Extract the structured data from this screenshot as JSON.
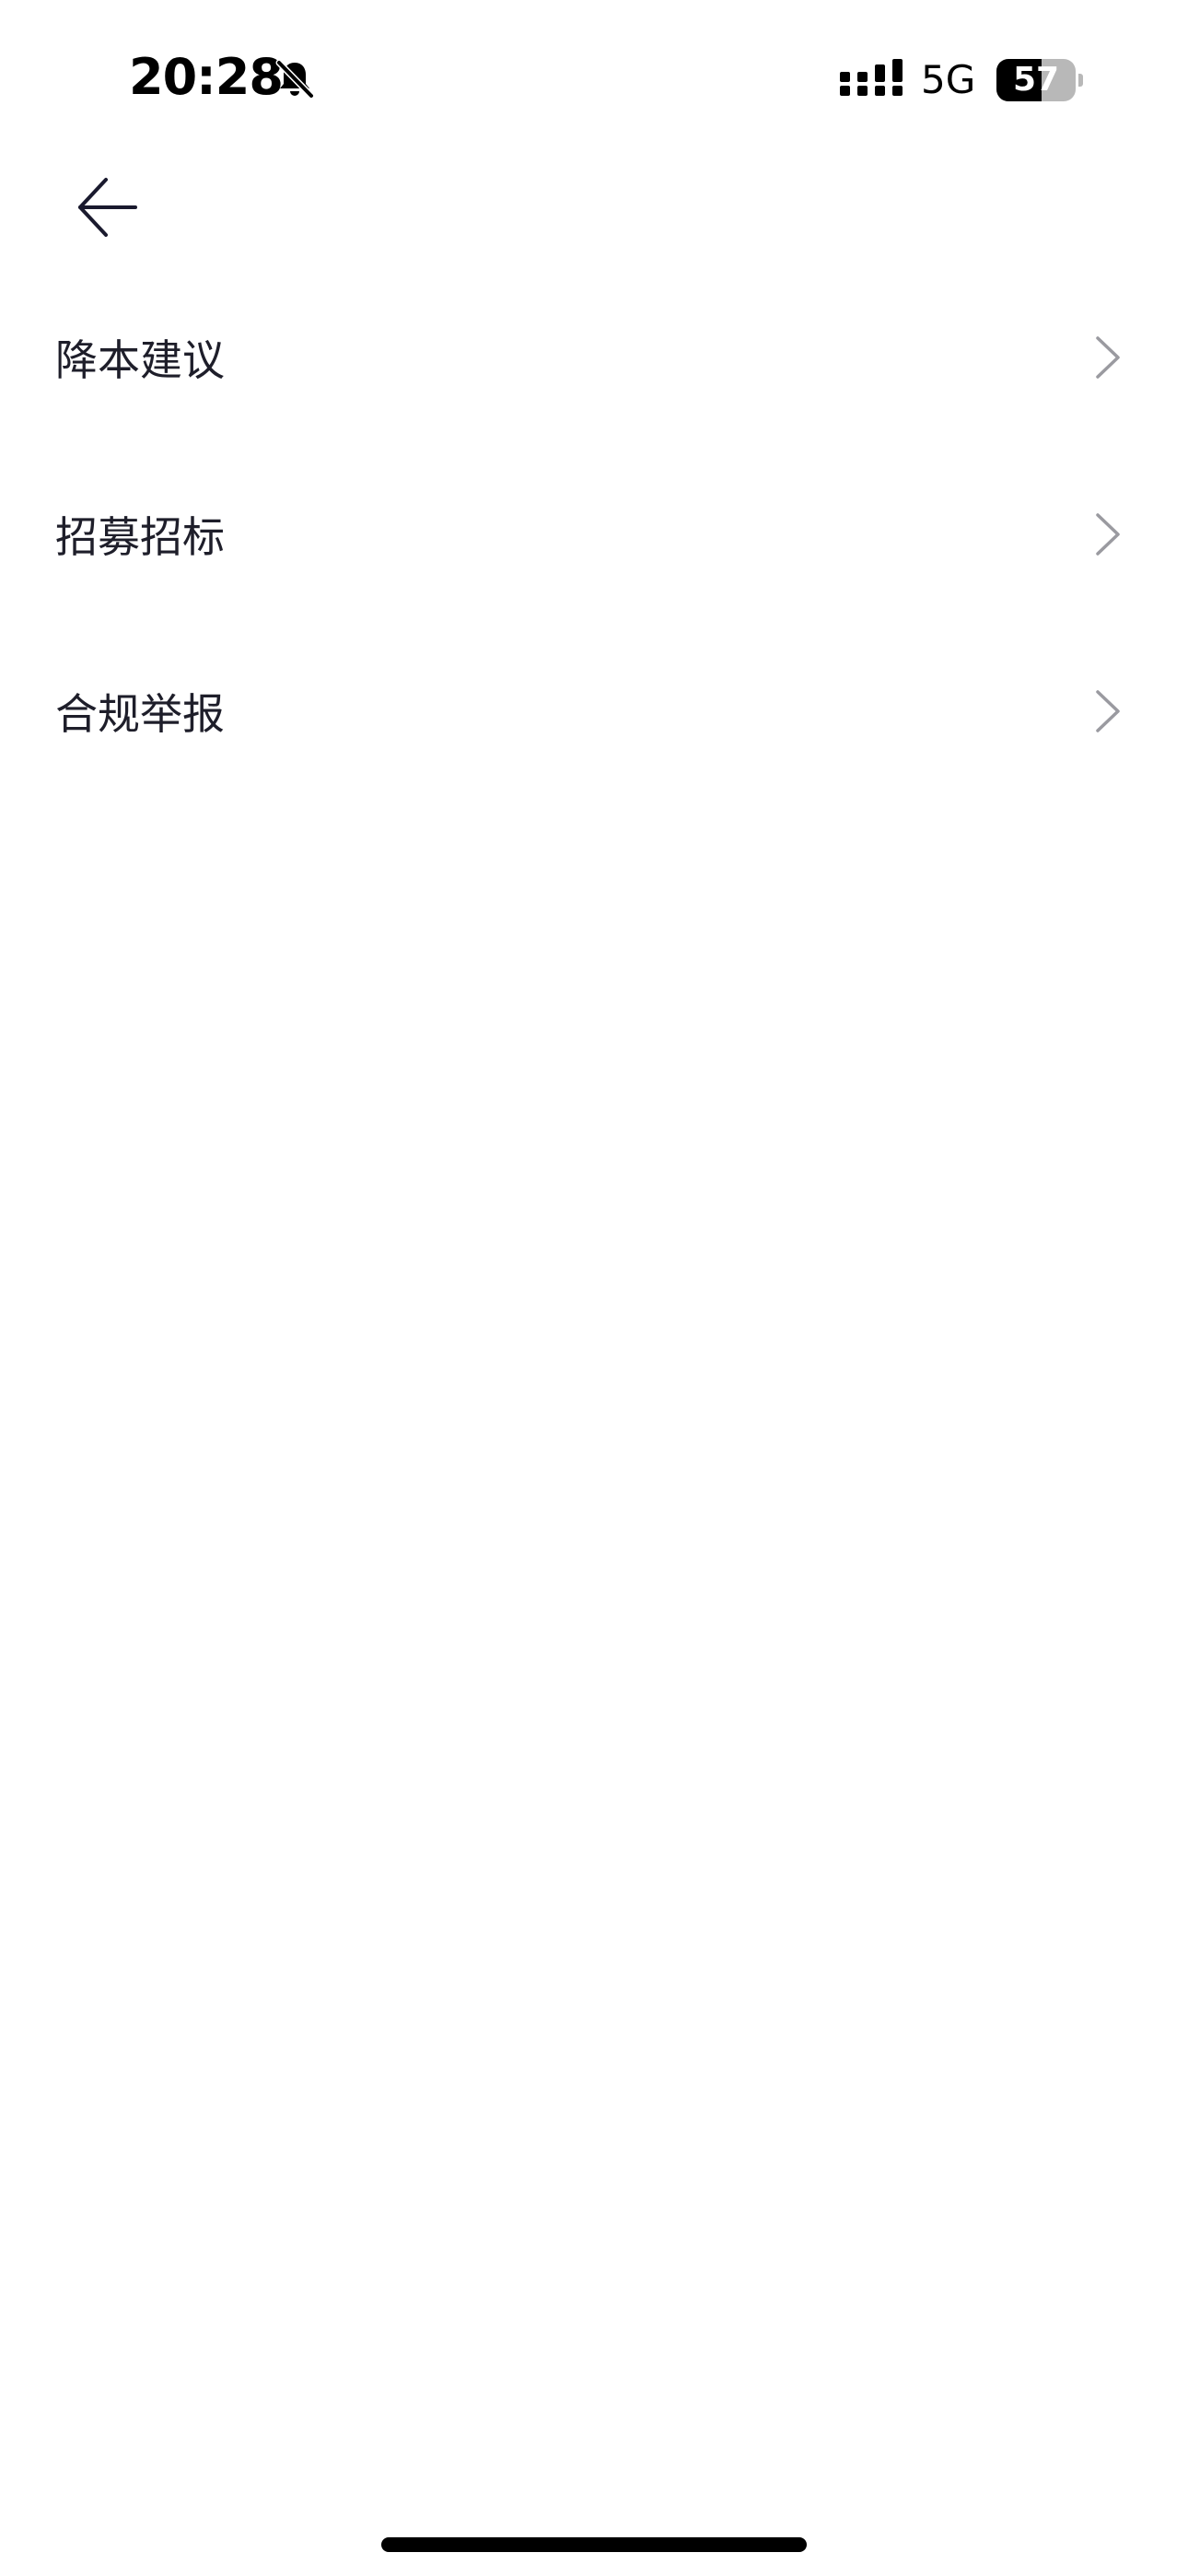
{
  "status_bar": {
    "time": "20:28",
    "network": "5G",
    "battery_level": "57",
    "battery_fraction": 0.57,
    "mute_icon": "bell-slash-icon",
    "signal_icon": "cellular-signal-icon"
  },
  "header": {
    "back_icon": "arrow-left-icon"
  },
  "menu": {
    "items": [
      {
        "label": "降本建议",
        "icon": "chevron-right-icon"
      },
      {
        "label": "招募招标",
        "icon": "chevron-right-icon"
      },
      {
        "label": "合规举报",
        "icon": "chevron-right-icon"
      }
    ]
  },
  "colors": {
    "background": "#ffffff",
    "text": "#1e1e2a",
    "chevron": "#9a9aa0",
    "battery_empty": "#b8b8b8"
  }
}
